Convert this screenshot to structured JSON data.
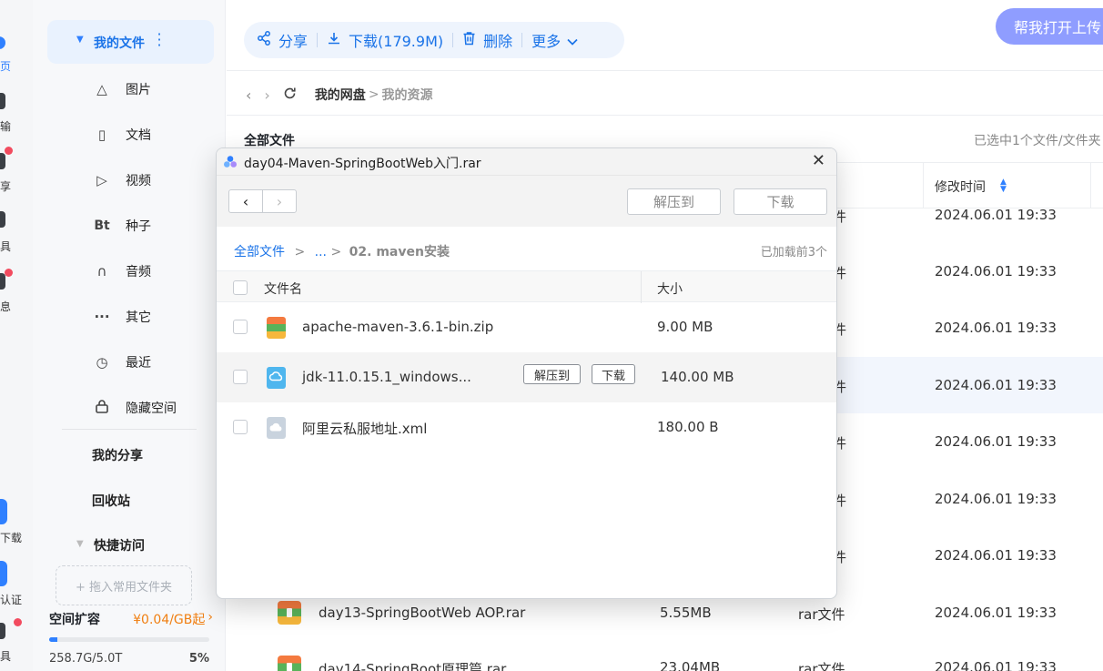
{
  "rail": {
    "items": [
      {
        "label": "页"
      },
      {
        "label": "输"
      },
      {
        "label": "享"
      },
      {
        "label": "具"
      },
      {
        "label": "息"
      },
      {
        "label": "下载"
      },
      {
        "label": "认证"
      },
      {
        "label": "具"
      }
    ]
  },
  "nav": {
    "my_files": "我的文件",
    "sub_items": [
      {
        "label": "图片"
      },
      {
        "label": "文档"
      },
      {
        "label": "视频"
      },
      {
        "label": "种子",
        "icon_text": "Bt"
      },
      {
        "label": "音频"
      },
      {
        "label": "其它"
      },
      {
        "label": "最近"
      },
      {
        "label": "隐藏空间"
      }
    ],
    "my_share": "我的分享",
    "recycle": "回收站",
    "quick_access": "快捷访问",
    "drop_zone": "+ 拖入常用文件夹",
    "expand_label": "空间扩容",
    "expand_price": "¥0.04/GB起",
    "expand_chevron": "›",
    "storage_used": "258.7G/5.0T",
    "storage_percent_text": "5%",
    "storage_fraction": 0.05
  },
  "toolbar": {
    "share": "分享",
    "download": "下载(179.9M)",
    "delete": "删除",
    "more": "更多"
  },
  "assist_button": "帮我打开上传",
  "breadcrumb": {
    "root": "我的网盘",
    "sep": ">",
    "current": "我的资源"
  },
  "main": {
    "section_title": "全部文件",
    "selection_status": "已选中1个文件/文件夹",
    "mtime_header": "修改时间",
    "partial_type": "件",
    "rows": [
      {
        "date": "2024.06.01 19:33"
      },
      {
        "date": "2024.06.01 19:33"
      },
      {
        "date": "2024.06.01 19:33"
      },
      {
        "date": "2024.06.01 19:33"
      },
      {
        "date": "2024.06.01 19:33"
      },
      {
        "date": "2024.06.01 19:33"
      },
      {
        "date": "2024.06.01 19:33"
      }
    ],
    "full_rows": [
      {
        "name": "day13-SpringBootWeb AOP.rar",
        "size": "5.55MB",
        "type": "rar文件",
        "date": "2024.06.01 19:33"
      },
      {
        "name": "day14-SpringBoot原理篇.rar",
        "size": "23.04MB",
        "type": "rar文件",
        "date": "2024.06.01 19:33"
      }
    ]
  },
  "dialog": {
    "title": "day04-Maven-SpringBootWeb入门.rar",
    "close": "✕",
    "extract_to": "解压到",
    "download": "下载",
    "crumb_root": "全部文件",
    "crumb_sep": ">",
    "crumb_ellipsis": "...",
    "crumb_current": "02. maven安装",
    "loaded_status": "已加载前3个",
    "header_name": "文件名",
    "header_size": "大小",
    "files": [
      {
        "name": "apache-maven-3.6.1-bin.zip",
        "size": "9.00 MB",
        "icon": "zip-icon"
      },
      {
        "name": "jdk-11.0.15.1_windows...",
        "size": "140.00 MB",
        "icon": "installer-icon"
      },
      {
        "name": "阿里云私服地址.xml",
        "size": "180.00 B",
        "icon": "cloud-file-icon"
      }
    ],
    "row_extract": "解压到",
    "row_download": "下载"
  },
  "colors": {
    "accent": "#1a73e8",
    "nav_highlight": "#e9f2fe",
    "assist_button": "#8f9dff",
    "badge": "#f24b5f",
    "price": "#f07f12"
  }
}
